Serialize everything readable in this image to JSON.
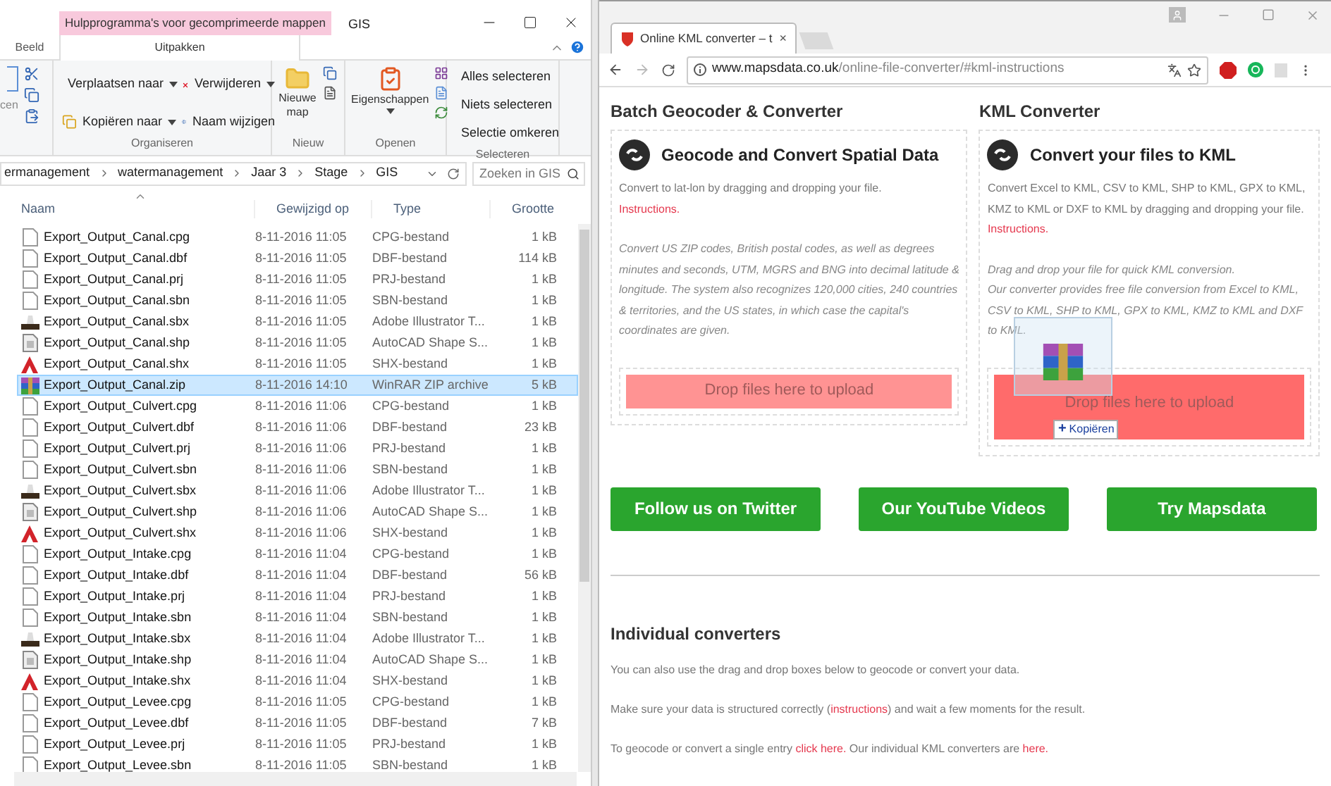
{
  "explorer": {
    "context_tab": "Hulpprogramma's voor gecomprimeerde mappen",
    "title": "GIS",
    "ribbon_tabs": [
      {
        "label": "Beeld",
        "selected": false
      },
      {
        "label": "Uitpakken",
        "selected": true
      }
    ],
    "clipboard_cut_label": "cen",
    "groups": [
      {
        "name": "Organiseren",
        "items": [
          "Verplaatsen naar",
          "Kopiëren naar",
          "Verwijderen",
          "Naam wijzigen"
        ]
      },
      {
        "name": "Nieuw",
        "items": [
          "Nieuwe map"
        ]
      },
      {
        "name": "Openen",
        "items": [
          "Eigenschappen"
        ]
      },
      {
        "name": "Selecteren",
        "items": [
          "Alles selecteren",
          "Niets selecteren",
          "Selectie omkeren"
        ]
      }
    ],
    "breadcrumb": [
      "ermanagement",
      "watermanagement",
      "Jaar 3",
      "Stage",
      "GIS"
    ],
    "search": {
      "placeholder": "Zoeken in GIS"
    },
    "columns": [
      "Naam",
      "Gewijzigd op",
      "Type",
      "Grootte"
    ],
    "rows": [
      {
        "kind": "file",
        "name": "Export_Output_Canal.cpg",
        "date": "8-11-2016 11:05",
        "type": "CPG-bestand",
        "size": "1 kB",
        "selected": false
      },
      {
        "kind": "file",
        "name": "Export_Output_Canal.dbf",
        "date": "8-11-2016 11:05",
        "type": "DBF-bestand",
        "size": "114 kB",
        "selected": false
      },
      {
        "kind": "file",
        "name": "Export_Output_Canal.prj",
        "date": "8-11-2016 11:05",
        "type": "PRJ-bestand",
        "size": "1 kB",
        "selected": false
      },
      {
        "kind": "file",
        "name": "Export_Output_Canal.sbn",
        "date": "8-11-2016 11:05",
        "type": "SBN-bestand",
        "size": "1 kB",
        "selected": false
      },
      {
        "kind": "sbx",
        "name": "Export_Output_Canal.sbx",
        "date": "8-11-2016 11:05",
        "type": "Adobe Illustrator T...",
        "size": "1 kB",
        "selected": false
      },
      {
        "kind": "shp",
        "name": "Export_Output_Canal.shp",
        "date": "8-11-2016 11:05",
        "type": "AutoCAD Shape S...",
        "size": "1 kB",
        "selected": false
      },
      {
        "kind": "shx",
        "name": "Export_Output_Canal.shx",
        "date": "8-11-2016 11:05",
        "type": "SHX-bestand",
        "size": "1 kB",
        "selected": false
      },
      {
        "kind": "zip",
        "name": "Export_Output_Canal.zip",
        "date": "8-11-2016 14:10",
        "type": "WinRAR ZIP archive",
        "size": "5 kB",
        "selected": true
      },
      {
        "kind": "file",
        "name": "Export_Output_Culvert.cpg",
        "date": "8-11-2016 11:06",
        "type": "CPG-bestand",
        "size": "1 kB",
        "selected": false
      },
      {
        "kind": "file",
        "name": "Export_Output_Culvert.dbf",
        "date": "8-11-2016 11:06",
        "type": "DBF-bestand",
        "size": "23 kB",
        "selected": false
      },
      {
        "kind": "file",
        "name": "Export_Output_Culvert.prj",
        "date": "8-11-2016 11:06",
        "type": "PRJ-bestand",
        "size": "1 kB",
        "selected": false
      },
      {
        "kind": "file",
        "name": "Export_Output_Culvert.sbn",
        "date": "8-11-2016 11:06",
        "type": "SBN-bestand",
        "size": "1 kB",
        "selected": false
      },
      {
        "kind": "sbx",
        "name": "Export_Output_Culvert.sbx",
        "date": "8-11-2016 11:06",
        "type": "Adobe Illustrator T...",
        "size": "1 kB",
        "selected": false
      },
      {
        "kind": "shp",
        "name": "Export_Output_Culvert.shp",
        "date": "8-11-2016 11:06",
        "type": "AutoCAD Shape S...",
        "size": "1 kB",
        "selected": false
      },
      {
        "kind": "shx",
        "name": "Export_Output_Culvert.shx",
        "date": "8-11-2016 11:06",
        "type": "SHX-bestand",
        "size": "1 kB",
        "selected": false
      },
      {
        "kind": "file",
        "name": "Export_Output_Intake.cpg",
        "date": "8-11-2016 11:04",
        "type": "CPG-bestand",
        "size": "1 kB",
        "selected": false
      },
      {
        "kind": "file",
        "name": "Export_Output_Intake.dbf",
        "date": "8-11-2016 11:04",
        "type": "DBF-bestand",
        "size": "56 kB",
        "selected": false
      },
      {
        "kind": "file",
        "name": "Export_Output_Intake.prj",
        "date": "8-11-2016 11:04",
        "type": "PRJ-bestand",
        "size": "1 kB",
        "selected": false
      },
      {
        "kind": "file",
        "name": "Export_Output_Intake.sbn",
        "date": "8-11-2016 11:04",
        "type": "SBN-bestand",
        "size": "1 kB",
        "selected": false
      },
      {
        "kind": "sbx",
        "name": "Export_Output_Intake.sbx",
        "date": "8-11-2016 11:04",
        "type": "Adobe Illustrator T...",
        "size": "1 kB",
        "selected": false
      },
      {
        "kind": "shp",
        "name": "Export_Output_Intake.shp",
        "date": "8-11-2016 11:04",
        "type": "AutoCAD Shape S...",
        "size": "1 kB",
        "selected": false
      },
      {
        "kind": "shx",
        "name": "Export_Output_Intake.shx",
        "date": "8-11-2016 11:04",
        "type": "SHX-bestand",
        "size": "1 kB",
        "selected": false
      },
      {
        "kind": "file",
        "name": "Export_Output_Levee.cpg",
        "date": "8-11-2016 11:05",
        "type": "CPG-bestand",
        "size": "1 kB",
        "selected": false
      },
      {
        "kind": "file",
        "name": "Export_Output_Levee.dbf",
        "date": "8-11-2016 11:05",
        "type": "DBF-bestand",
        "size": "7 kB",
        "selected": false
      },
      {
        "kind": "file",
        "name": "Export_Output_Levee.prj",
        "date": "8-11-2016 11:05",
        "type": "PRJ-bestand",
        "size": "1 kB",
        "selected": false
      },
      {
        "kind": "file",
        "name": "Export_Output_Levee.sbn",
        "date": "8-11-2016 11:05",
        "type": "SBN-bestand",
        "size": "1 kB",
        "selected": false
      }
    ]
  },
  "browser": {
    "tab": {
      "title": "Online KML converter – t",
      "close": "×"
    },
    "url": {
      "host": "www.mapsdata.co.uk",
      "path": "/online-file-converter/#kml-instructions"
    },
    "sections": [
      {
        "heading": "Batch Geocoder & Converter",
        "card_title": "Geocode and Convert Spatial Data",
        "intro": "Convert to lat-lon by dragging and dropping your file.",
        "link": "Instructions.",
        "details": [
          "Convert US ZIP codes, British postal codes, as well as degrees minutes and seconds, UTM, MGRS and BNG into decimal latitude & longitude. The system also recognizes 120,000 cities, 240 countries & territories, and the US states, in which case the capital's coordinates are given."
        ],
        "dropzone": "Drop files here to upload",
        "drag_over": false
      },
      {
        "heading": "KML Converter",
        "card_title": "Convert your files to KML",
        "intro": "Convert Excel to KML, CSV to KML, SHP to KML, GPX to KML, KMZ to KML or DXF to KML by dragging and dropping your file.",
        "link": "Instructions.",
        "details": [
          "Drag and drop your file for quick KML conversion.",
          "Our converter provides free file conversion from Excel to KML, CSV to KML, SHP to KML, GPX to KML, KMZ to KML and DXF to KML."
        ],
        "dropzone": "Drop files here to upload",
        "drag_over": true
      }
    ],
    "drag_tooltip": {
      "sign": "+",
      "label": "Kopiëren"
    },
    "buttons": [
      "Follow us on Twitter",
      "Our YouTube Videos",
      "Try Mapsdata"
    ],
    "individual": {
      "heading": "Individual converters",
      "paragraphs": [
        [
          {
            "text": "You can also use the drag and drop boxes below to geocode or convert your data.",
            "link": false
          }
        ],
        [
          {
            "text": "Make sure your data is structured correctly (",
            "link": false
          },
          {
            "text": "instructions",
            "link": true
          },
          {
            "text": ") and wait a few moments for the result.",
            "link": false
          }
        ],
        [
          {
            "text": "To geocode or convert a single entry ",
            "link": false
          },
          {
            "text": "click here.",
            "link": true
          },
          {
            "text": " Our individual KML converters are ",
            "link": false
          },
          {
            "text": "here.",
            "link": true
          }
        ]
      ]
    }
  }
}
